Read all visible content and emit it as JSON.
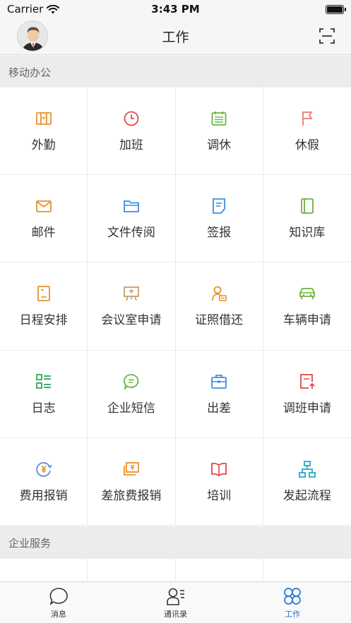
{
  "status_bar": {
    "carrier": "Carrier",
    "time": "3:43 PM"
  },
  "header": {
    "title": "工作"
  },
  "sections": [
    {
      "title": "移动办公"
    },
    {
      "title": "企业服务"
    }
  ],
  "grid_items": [
    {
      "label": "外勤",
      "icon": "field-work-icon",
      "color": "#e8902e"
    },
    {
      "label": "加班",
      "icon": "clock-icon",
      "color": "#e0484a"
    },
    {
      "label": "调休",
      "icon": "calendar-icon",
      "color": "#6cb33e"
    },
    {
      "label": "休假",
      "icon": "flag-icon",
      "color": "#f07a6a"
    },
    {
      "label": "邮件",
      "icon": "mail-icon",
      "color": "#e8902e"
    },
    {
      "label": "文件传阅",
      "icon": "folder-icon",
      "color": "#3a8ee6"
    },
    {
      "label": "签报",
      "icon": "document-sign-icon",
      "color": "#3a8ee6"
    },
    {
      "label": "知识库",
      "icon": "book-icon",
      "color": "#6cb33e"
    },
    {
      "label": "日程安排",
      "icon": "schedule-icon",
      "color": "#e8902e"
    },
    {
      "label": "会议室申请",
      "icon": "meeting-room-icon",
      "color": "#c8a06a"
    },
    {
      "label": "证照借还",
      "icon": "license-icon",
      "color": "#e8902e"
    },
    {
      "label": "车辆申请",
      "icon": "car-icon",
      "color": "#6cb33e"
    },
    {
      "label": "日志",
      "icon": "log-list-icon",
      "color": "#2eaa5c"
    },
    {
      "label": "企业短信",
      "icon": "chat-bubble-icon",
      "color": "#6cb33e"
    },
    {
      "label": "出差",
      "icon": "briefcase-icon",
      "color": "#3a8ee6"
    },
    {
      "label": "调班申请",
      "icon": "shift-request-icon",
      "color": "#e0484a"
    },
    {
      "label": "费用报销",
      "icon": "yen-refund-icon",
      "color": "#5a8fd0"
    },
    {
      "label": "差旅费报销",
      "icon": "yen-cash-icon",
      "color": "#e8902e"
    },
    {
      "label": "培训",
      "icon": "open-book-icon",
      "color": "#e0484a"
    },
    {
      "label": "发起流程",
      "icon": "flowchart-icon",
      "color": "#2aa7c9"
    }
  ],
  "tabs": [
    {
      "label": "消息",
      "icon": "message-bubble-icon",
      "active": false
    },
    {
      "label": "通讯录",
      "icon": "contacts-icon",
      "active": true
    },
    {
      "label": "工作",
      "icon": "work-grid-icon",
      "active": true
    }
  ],
  "colors": {
    "accent": "#1e78d4",
    "section_bg": "#ececec"
  }
}
